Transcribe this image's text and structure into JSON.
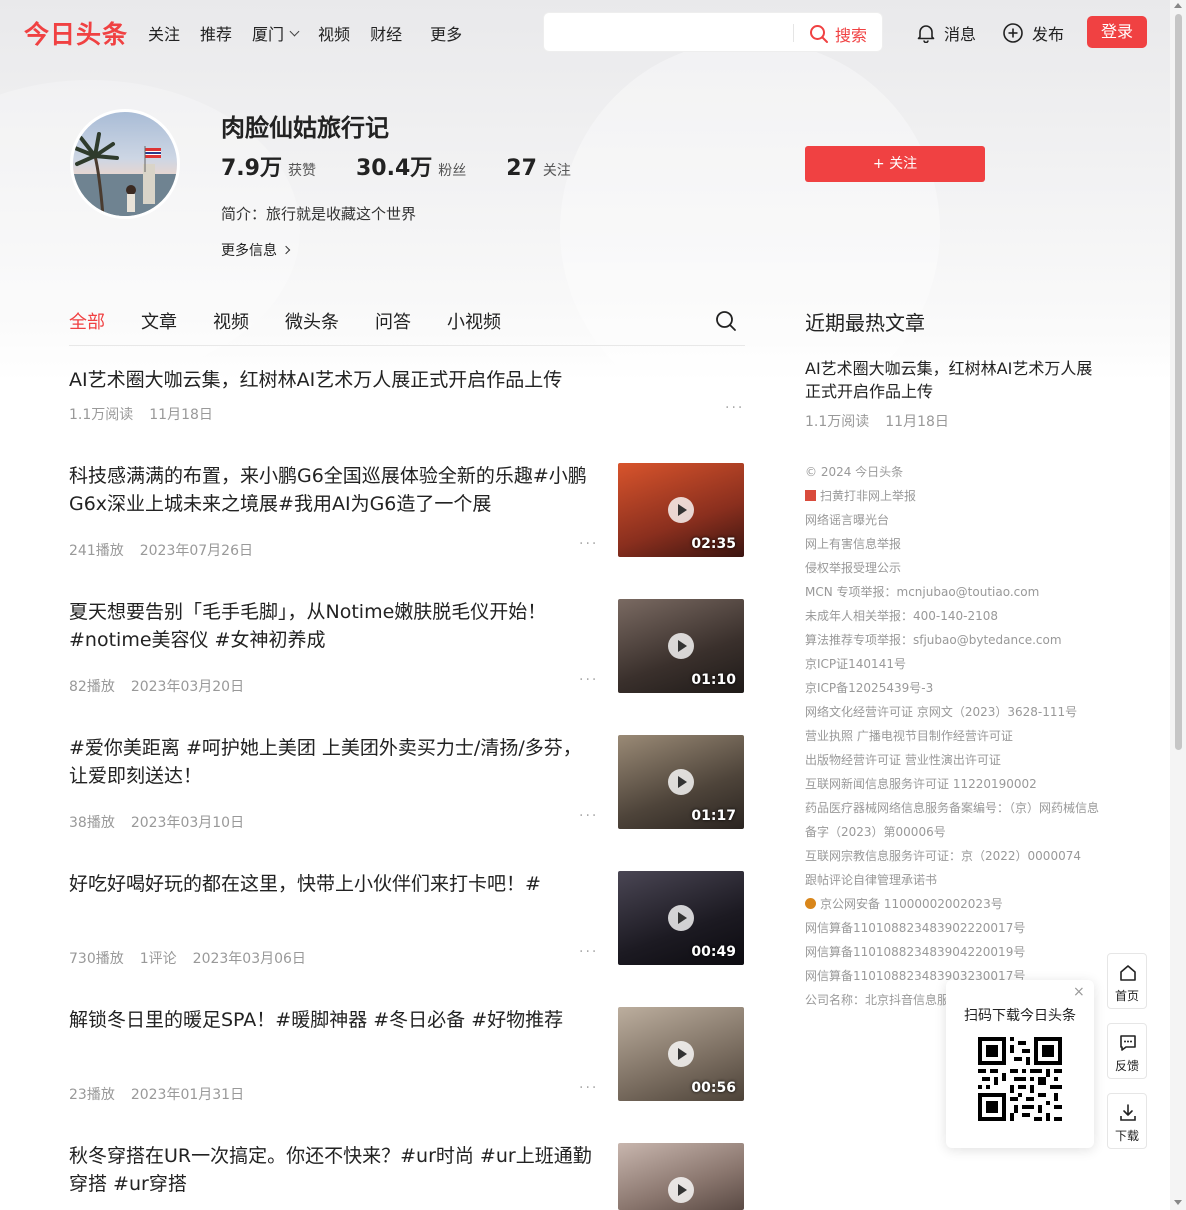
{
  "header": {
    "logo": "今日头条",
    "nav": [
      "关注",
      "推荐",
      "厦门",
      "视频",
      "财经",
      "更多"
    ],
    "search_placeholder": "",
    "search_button": "搜索",
    "messages": "消息",
    "publish": "发布",
    "login": "登录"
  },
  "profile": {
    "name": "肉脸仙姑旅行记",
    "likes_num": "7.9万",
    "likes_label": "获赞",
    "fans_num": "30.4万",
    "fans_label": "粉丝",
    "following_num": "27",
    "following_label": "关注",
    "intro": "简介：旅行就是收藏这个世界",
    "more_info": "更多信息",
    "follow_button": "+ 关注"
  },
  "tabs": [
    "全部",
    "文章",
    "视频",
    "微头条",
    "问答",
    "小视频"
  ],
  "feed": [
    {
      "title": "AI艺术圈大咖云集，红树林AI艺术万人展正式开启作品上传",
      "meta": [
        "1.1万阅读",
        "11月18日"
      ]
    },
    {
      "title": "科技感满满的布置，来小鹏G6全国巡展体验全新的乐趣#小鹏G6x深业上城未来之境展#我用AI为G6造了一个展",
      "meta": [
        "241播放",
        "2023年07月26日"
      ],
      "duration": "02:35",
      "thumb_colors": [
        "#c9462a",
        "#7a2a1c"
      ]
    },
    {
      "title": "夏天想要告别「毛手毛脚」，从Notime嫩肤脱毛仪开始！#notime美容仪 #女神初养成",
      "meta": [
        "82播放",
        "2023年03月20日"
      ],
      "duration": "01:10",
      "thumb_colors": [
        "#5a4a44",
        "#2f2a28"
      ]
    },
    {
      "title": "#爱你美距离 #呵护她上美团 上美团外卖买力士/清扬/多芬，让爱即刻送达！",
      "meta": [
        "38播放",
        "2023年03月10日"
      ],
      "duration": "01:17",
      "thumb_colors": [
        "#7b6d5c",
        "#3b342c"
      ]
    },
    {
      "title": "好吃好喝好玩的都在这里，快带上小伙伴们来打卡吧！#",
      "meta": [
        "730播放",
        "1评论",
        "2023年03月06日"
      ],
      "duration": "00:49",
      "thumb_colors": [
        "#3d3a44",
        "#141218"
      ]
    },
    {
      "title": "解锁冬日里的暖足SPA！#暖脚神器 #冬日必备 #好物推荐",
      "meta": [
        "23播放",
        "2023年01月31日"
      ],
      "duration": "00:56",
      "thumb_colors": [
        "#a99888",
        "#6a5e52"
      ]
    },
    {
      "title": "秋冬穿搭在UR一次搞定。你还不快来？#ur时尚 #ur上班通勤穿搭 #ur穿搭",
      "meta": [],
      "duration": "",
      "thumb_colors": [
        "#b4a39c",
        "#6e5e58"
      ]
    }
  ],
  "sidebar": {
    "hot_heading": "近期最热文章",
    "hot_title": "AI艺术圈大咖云集，红树林AI艺术万人展正式开启作品上传",
    "hot_meta": [
      "1.1万阅读",
      "11月18日"
    ],
    "footer": [
      "© 2024 今日头条",
      "扫黄打非网上举报",
      "网络谣言曝光台",
      "网上有害信息举报",
      "侵权举报受理公示",
      "MCN 专项举报：mcnjubao@toutiao.com",
      "未成年人相关举报：400-140-2108",
      "算法推荐专项举报：sfjubao@bytedance.com",
      "京ICP证140141号",
      "京ICP备12025439号-3",
      "网络文化经营许可证 京网文（2023）3628-111号",
      "营业执照 广播电视节目制作经营许可证",
      "出版物经营许可证 营业性演出许可证",
      "互联网新闻信息服务许可证 11220190002",
      "药品医疗器械网络信息服务备案编号：（京）网药械信息",
      "备字（2023）第00006号",
      "互联网宗教信息服务许可证：京（2022）0000074",
      "跟帖评论自律管理承诺书",
      "京公网安备 11000002002023号",
      "网信算备110108823483902220017号",
      "网信算备110108823483904220019号",
      "网信算备110108823483903230017号",
      "公司名称：北京抖音信息服务有限公司"
    ]
  },
  "qr_popup": {
    "title": "扫码下载今日头条",
    "close": "×"
  },
  "tools": [
    "首页",
    "反馈",
    "下载"
  ],
  "colors": {
    "brand": "#f04142"
  }
}
